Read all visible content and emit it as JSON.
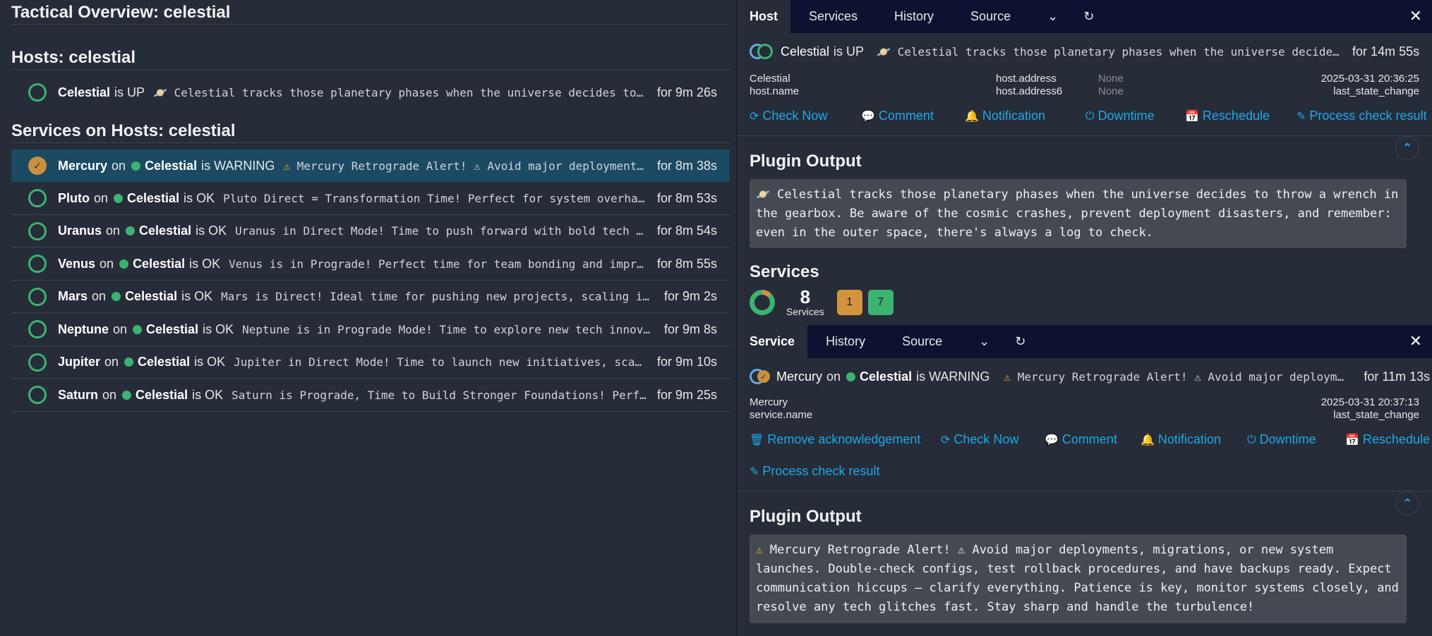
{
  "left": {
    "title": "Tactical Overview: celestial",
    "hosts_title": "Hosts: celestial",
    "services_title": "Services on Hosts: celestial",
    "host_row": {
      "name": "Celestial",
      "state_text": "is UP",
      "output": "Celestial tracks those planetary phases when the universe decides to throw a wrench in the gearbox.",
      "duration": "for 9m 26s"
    },
    "services": [
      {
        "name": "Mercury",
        "on": "on",
        "host": "Celestial",
        "state": "is WARNING",
        "output": "Mercury Retrograde Alert! ⚠ Avoid major deployments, migrations, or new system launches.",
        "duration": "for 8m 38s",
        "status": "warning",
        "selected": true
      },
      {
        "name": "Pluto",
        "on": "on",
        "host": "Celestial",
        "state": "is OK",
        "output": "Pluto Direct = Transformation Time! Perfect for system overhauls, major refactors.",
        "duration": "for 8m 53s",
        "status": "ok"
      },
      {
        "name": "Uranus",
        "on": "on",
        "host": "Celestial",
        "state": "is OK",
        "output": "Uranus in Direct Mode! Time to push forward with bold tech projects.",
        "duration": "for 8m 54s",
        "status": "ok"
      },
      {
        "name": "Venus",
        "on": "on",
        "host": "Celestial",
        "state": "is OK",
        "output": "Venus is in Prograde! Perfect time for team bonding and improving collaboration.",
        "duration": "for 8m 55s",
        "status": "ok"
      },
      {
        "name": "Mars",
        "on": "on",
        "host": "Celestial",
        "state": "is OK",
        "output": "Mars is Direct! Ideal time for pushing new projects, scaling infrastructure.",
        "duration": "for 9m 2s",
        "status": "ok"
      },
      {
        "name": "Neptune",
        "on": "on",
        "host": "Celestial",
        "state": "is OK",
        "output": "Neptune is in Prograde Mode! Time to explore new tech innovations.",
        "duration": "for 9m 8s",
        "status": "ok"
      },
      {
        "name": "Jupiter",
        "on": "on",
        "host": "Celestial",
        "state": "is OK",
        "output": "Jupiter in Direct Mode! Time to launch new initiatives, scale infrastructure.",
        "duration": "for 9m 10s",
        "status": "ok"
      },
      {
        "name": "Saturn",
        "on": "on",
        "host": "Celestial",
        "state": "is OK",
        "output": "Saturn is Prograde, Time to Build Stronger Foundations! Perfect for refactoring.",
        "duration": "for 9m 25s",
        "status": "ok"
      }
    ]
  },
  "host_panel": {
    "tabs": [
      "Host",
      "Services",
      "History",
      "Source"
    ],
    "header": {
      "name": "Celestial",
      "state": "is UP",
      "output": "Celestial tracks those planetary phases when the universe decides to throw a wrench in the gearbox.",
      "duration": "for 14m 55s"
    },
    "fields": {
      "display_name": "Celestial",
      "name_label": "host.name",
      "address_label": "host.address",
      "address_value": "None",
      "address6_label": "host.address6",
      "address6_value": "None",
      "last_change_value": "2025-03-31 20:36:25",
      "last_change_label": "last_state_change"
    },
    "actions": [
      "Check Now",
      "Comment",
      "Notification",
      "Downtime",
      "Reschedule",
      "Process check result"
    ],
    "plugin_output_title": "Plugin Output",
    "plugin_output": "Celestial tracks those planetary phases when the universe decides to throw a wrench in the gearbox. Be aware of the cosmic crashes, prevent deployment disasters, and remember: even in the outer space, there's always a log to check.",
    "services_title": "Services",
    "services_count": "8",
    "services_count_label": "Services",
    "badge_warning": "1",
    "badge_ok": "7",
    "colors": {
      "warning": "#d4943e",
      "ok": "#3cb371"
    }
  },
  "service_panel": {
    "tabs": [
      "Service",
      "History",
      "Source"
    ],
    "header": {
      "name": "Mercury",
      "on": "on",
      "host": "Celestial",
      "state": "is WARNING",
      "output": "Mercury Retrograde Alert! ⚠ Avoid major deployments, migrations, or new system launches.",
      "duration": "for 11m 13s"
    },
    "fields": {
      "display_name": "Mercury",
      "name_label": "service.name",
      "last_change_value": "2025-03-31 20:37:13",
      "last_change_label": "last_state_change"
    },
    "actions": [
      "Remove acknowledgement",
      "Check Now",
      "Comment",
      "Notification",
      "Downtime",
      "Reschedule"
    ],
    "action_process": "Process check result",
    "plugin_output_title": "Plugin Output",
    "plugin_output": "Mercury Retrograde Alert! ⚠ Avoid major deployments, migrations, or new system launches. Double-check configs, test rollback procedures, and have backups ready. Expect communication hiccups — clarify everything. Patience is key, monitor systems closely, and resolve any tech glitches fast. Stay sharp and handle the turbulence!"
  }
}
